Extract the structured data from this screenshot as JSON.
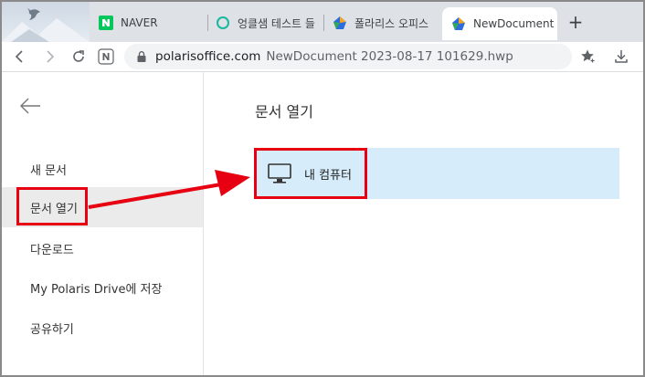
{
  "browser": {
    "tabs": [
      {
        "title": "NAVER",
        "favicon": "naver-icon"
      },
      {
        "title": "엉클샘 테스트 들",
        "favicon": "circle-icon"
      },
      {
        "title": "폴라리스 오피스",
        "favicon": "polaris-icon"
      },
      {
        "title": "NewDocument",
        "favicon": "polaris-icon",
        "active": true
      }
    ],
    "close_label": "×",
    "new_tab_label": "+",
    "address": {
      "host": "polarisoffice.com",
      "path": "NewDocument 2023-08-17 101629.hwp"
    }
  },
  "sidebar": {
    "items": [
      {
        "label": "새 문서"
      },
      {
        "label": "문서 열기",
        "selected": true
      },
      {
        "label": "다운로드"
      },
      {
        "label": "My Polaris Drive에 저장"
      },
      {
        "label": "공유하기"
      }
    ]
  },
  "main": {
    "title": "문서 열기",
    "locations": [
      {
        "label": "내 컴퓨터",
        "icon": "monitor-icon"
      }
    ]
  },
  "colors": {
    "annotation_red": "#e60012",
    "selected_row": "#d6ecfa",
    "sidebar_selected": "#ebebeb"
  }
}
